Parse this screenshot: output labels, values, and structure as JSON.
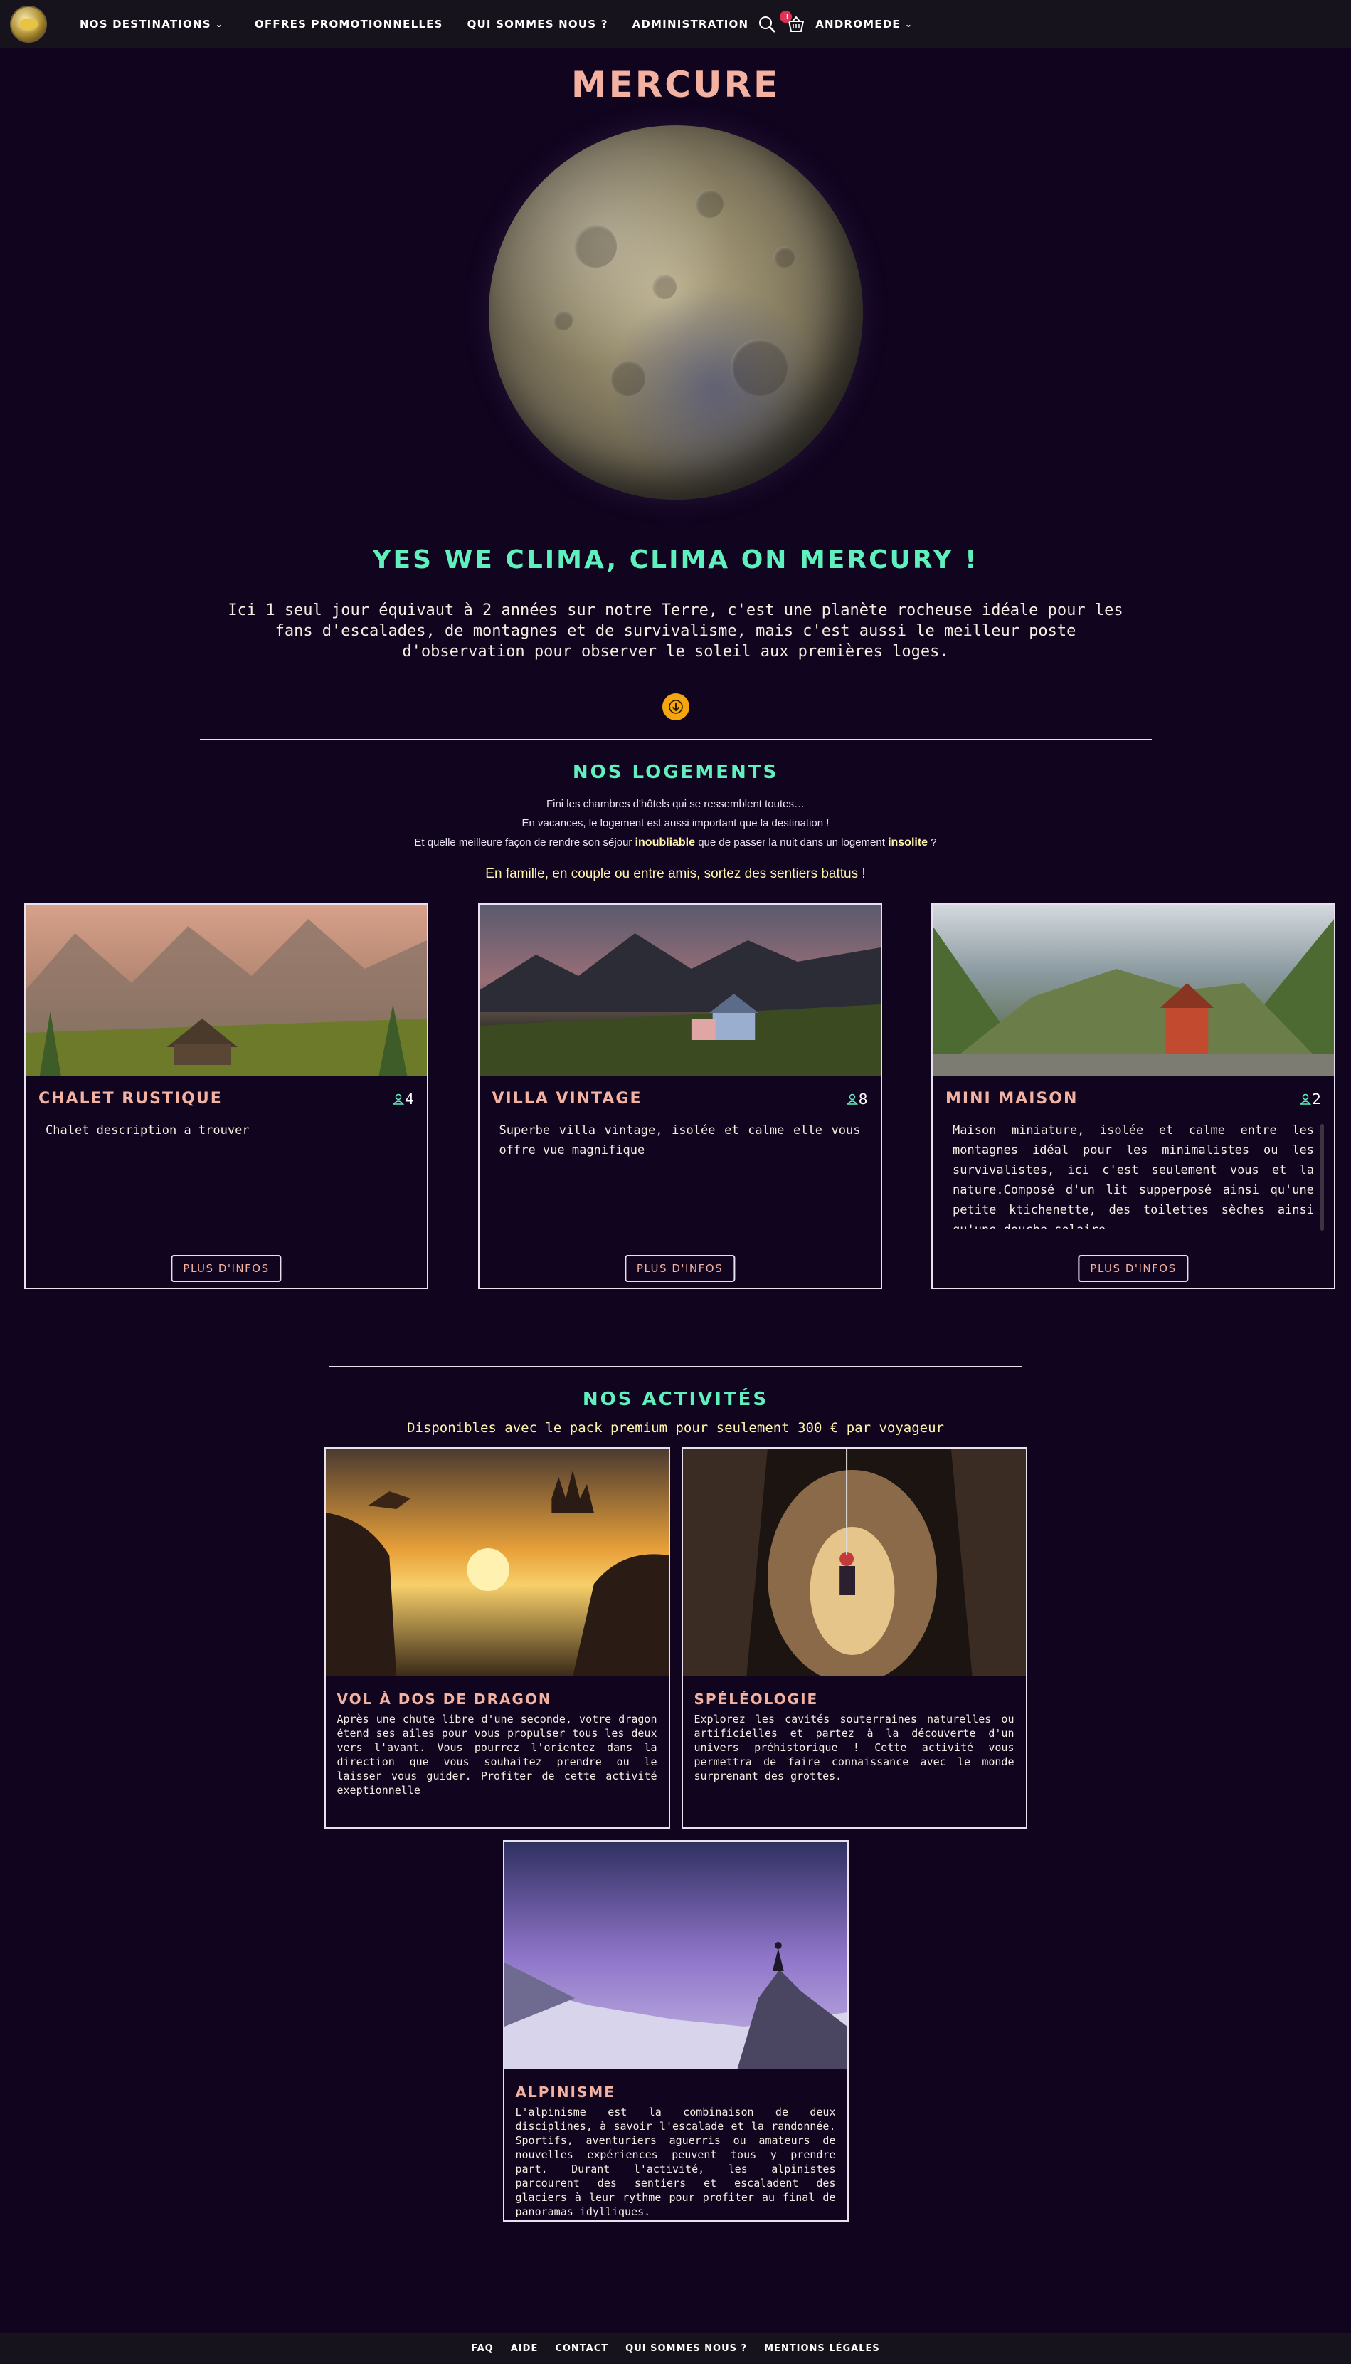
{
  "navbar": {
    "destinations_label": "Nos destinations",
    "promotions_label": "Offres promotionnelles",
    "about_label": "Qui sommes nous ?",
    "admin_label": "Administration",
    "cart_count": "3",
    "user_label": "Andromede"
  },
  "hero": {
    "planet_name": "Mercure",
    "tagline": "Yes we clima, clima on Mercury !",
    "description": "Ici 1 seul jour équivaut à 2 années sur notre Terre, c'est une planète rocheuse idéale pour les fans d'escalades, de montagnes et de survivalisme, mais c'est aussi le meilleur poste d'observation pour observer le soleil aux premières loges."
  },
  "logements": {
    "title": "Nos logements",
    "intro_line1": "Fini les chambres d'hôtels qui se ressemblent toutes…",
    "intro_line2": "En vacances, le logement est aussi important que la destination !",
    "intro_line3_a": "Et quelle meilleure façon de rendre son séjour ",
    "intro_line3_hl1": "inoubliable",
    "intro_line3_b": " que de passer la nuit dans un logement ",
    "intro_line3_hl2": "insolite",
    "intro_line3_c": " ?",
    "cta": "En famille, en couple ou entre amis, sortez des sentiers battus !",
    "more_label": "Plus d'infos",
    "items": [
      {
        "title": "Chalet rustique",
        "capacity": "4",
        "description": "Chalet description a trouver"
      },
      {
        "title": "Villa vintage",
        "capacity": "8",
        "description": "Superbe villa vintage, isolée et calme elle vous offre vue magnifique"
      },
      {
        "title": "Mini maison",
        "capacity": "2",
        "description": "Maison miniature, isolée et calme entre les montagnes idéal pour les minimalistes ou les survivalistes, ici c'est seulement vous et la nature.Composé d'un lit supperposé ainsi qu'une petite ktichenette, des toilettes sèches ainsi qu'une douche solaire"
      }
    ]
  },
  "activites": {
    "title": "Nos activités",
    "premium": "Disponibles avec le pack premium pour seulement 300 € par voyageur",
    "items": [
      {
        "title": "Vol à dos de dragon",
        "description": "Après une chute libre d'une seconde, votre dragon étend ses ailes pour vous propulser tous les deux vers l'avant. Vous pourrez l'orientez dans la direction que vous souhaitez prendre ou le laisser vous guider. Profiter de cette activité exeptionnelle"
      },
      {
        "title": "Spéléologie",
        "description": "Explorez les cavités souterraines naturelles ou artificielles et partez à la découverte d'un univers préhistorique ! Cette activité vous permettra de faire connaissance avec le monde surprenant des grottes."
      },
      {
        "title": "Alpinisme",
        "description": "L'alpinisme est la combinaison de deux disciplines, à savoir l'escalade et la randonnée. Sportifs, aventuriers aguerris ou amateurs de nouvelles expériences peuvent tous y prendre part. Durant l'activité, les alpinistes parcourent des sentiers et escaladent des glaciers à leur rythme pour profiter au final de panoramas idylliques."
      }
    ]
  },
  "footer": {
    "faq": "FAQ",
    "aide": "Aide",
    "contact": "Contact",
    "about": "Qui sommes nous ?",
    "legal": "Mentions légales"
  },
  "colors": {
    "background": "#11041f",
    "navbar": "#17131d",
    "accent_title": "#f2b1a1",
    "accent_green": "#5ff0bd",
    "highlight_yellow": "#fff5a8",
    "scroll_button": "#f5a60f",
    "badge": "#e03155"
  },
  "icons": [
    "site-logo",
    "chevron-down-icon",
    "search-icon",
    "cart-icon",
    "user-icon",
    "arrow-down-icon"
  ]
}
